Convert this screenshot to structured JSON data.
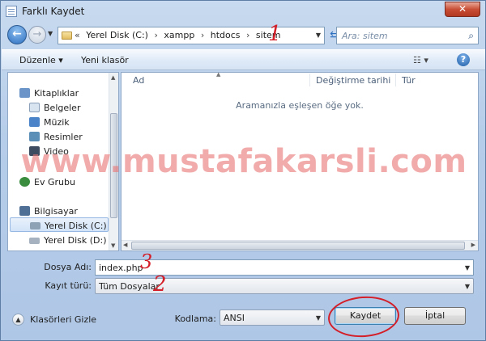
{
  "window": {
    "title": "Farklı Kaydet",
    "close_label": "✕"
  },
  "address": {
    "crumbs": [
      "Yerel Disk (C:)",
      "xampp",
      "htdocs",
      "sitem"
    ],
    "lead": "«",
    "sep": "›",
    "search_placeholder": "Ara: sitem",
    "annotation": "1"
  },
  "toolbar": {
    "organize_label": "Düzenle ▾",
    "new_folder_label": "Yeni klasör",
    "view_label": "☷ ▾",
    "help_label": "?"
  },
  "nav": {
    "items": [
      {
        "label": "Kitaplıklar",
        "icon": "libraries-icon",
        "color": "#6b95c8"
      },
      {
        "label": "Belgeler",
        "icon": "documents-icon",
        "color": "#d9e4f1"
      },
      {
        "label": "Müzik",
        "icon": "music-icon",
        "color": "#4a83c7"
      },
      {
        "label": "Resimler",
        "icon": "pictures-icon",
        "color": "#5b8fb8"
      },
      {
        "label": "Video",
        "icon": "video-icon",
        "color": "#3d4c61"
      },
      {
        "label": "Ev Grubu",
        "icon": "homegroup-icon",
        "color": "#3a8d3e"
      },
      {
        "label": "Bilgisayar",
        "icon": "computer-icon",
        "color": "#4f6f95"
      },
      {
        "label": "Yerel Disk (C:)",
        "icon": "drive-c-icon",
        "color": "#8ea2b6"
      },
      {
        "label": "Yerel Disk (D:)",
        "icon": "drive-d-icon",
        "color": "#a6b2bf"
      }
    ]
  },
  "files": {
    "columns": [
      "Ad",
      "Değiştirme tarihi",
      "Tür"
    ],
    "empty_message": "Aramanızla eşleşen öğe yok."
  },
  "watermark": "www.mustafakarsli.com",
  "form": {
    "filename_label": "Dosya Adı:",
    "filename_value": "index.php",
    "filetype_label": "Kayıt türü:",
    "filetype_value": "Tüm Dosyalar",
    "encoding_label": "Kodlama:",
    "encoding_value": "ANSI",
    "annotation_filename": "3",
    "annotation_filetype": "2"
  },
  "footer": {
    "hide_folders_label": "Klasörleri Gizle",
    "save_label": "Kaydet",
    "cancel_label": "İptal"
  },
  "colors": {
    "annotation": "#d41e28",
    "watermark": "#e87878",
    "accent": "#2d6fc0"
  }
}
